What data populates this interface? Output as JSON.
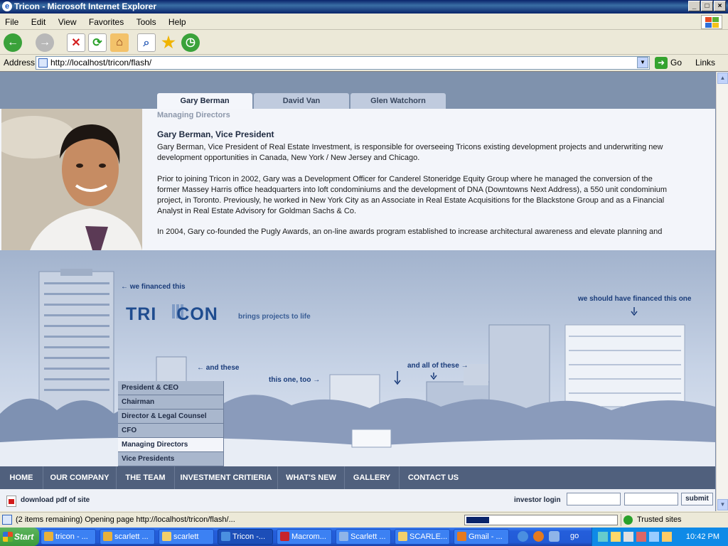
{
  "window": {
    "title": "Tricon - Microsoft Internet Explorer"
  },
  "menu": [
    "File",
    "Edit",
    "View",
    "Favorites",
    "Tools",
    "Help"
  ],
  "address": {
    "label": "Address",
    "url": "http://localhost/tricon/flash/",
    "go_label": "Go",
    "links_label": "Links"
  },
  "tabs": [
    {
      "label": "Gary Berman",
      "active": true
    },
    {
      "label": "David Van",
      "active": false
    },
    {
      "label": "Glen Watchorn",
      "active": false
    }
  ],
  "section_label": "Managing Directors",
  "bio": {
    "heading": "Gary Berman, Vice President",
    "paragraphs": [
      "Gary Berman, Vice President of Real Estate Investment, is responsible for overseeing Tricons existing development projects and underwriting new development opportunities in Canada, New York / New Jersey and Chicago.",
      "Prior to joining Tricon in 2002, Gary was a Development Officer for Canderel Stoneridge Equity Group where he managed the conversion of the former Massey Harris office headquarters into loft condominiums and the development of DNA (Downtowns Next Address), a 550 unit condominium project, in Toronto.  Previously, he worked in New York City as an Associate in Real Estate Acquisitions for the Blackstone Group and as a Financial Analyst in Real Estate Advisory for Goldman Sachs & Co.",
      "In 2004, Gary co-founded the Pugly Awards, an on-line awards program established to increase architectural awareness and elevate planning and"
    ]
  },
  "scene": {
    "logo": "TRI CON",
    "tagline": "brings projects to life",
    "notes": {
      "financed": "← we financed this",
      "should": "we should have financed this one",
      "and_these": "← and these",
      "this_one": "this one, too →",
      "all_these": "and all of these →"
    }
  },
  "side_menu": [
    {
      "label": "President & CEO",
      "active": false
    },
    {
      "label": "Chairman",
      "active": false
    },
    {
      "label": "Director & Legal Counsel",
      "active": false
    },
    {
      "label": "CFO",
      "active": false
    },
    {
      "label": "Managing Directors",
      "active": true
    },
    {
      "label": "Vice Presidents",
      "active": false
    }
  ],
  "nav": [
    "HOME",
    "OUR COMPANY",
    "THE TEAM",
    "INVESTMENT CRITIERIA",
    "WHAT'S NEW",
    "GALLERY",
    "CONTACT US"
  ],
  "footer": {
    "pdf_label": "download pdf of site",
    "login_label": "investor login",
    "submit_label": "submit"
  },
  "status": {
    "text": "(2 items remaining) Opening page http://localhost/tricon/flash/...",
    "zone": "Trusted sites",
    "progress": 0.15
  },
  "taskbar": {
    "start": "Start",
    "tasks": [
      {
        "label": "tricon - ...",
        "icon": "chrome-icon",
        "color": "#e8b13a",
        "active": false
      },
      {
        "label": "scarlett ...",
        "icon": "chrome-icon",
        "color": "#e8b13a",
        "active": false
      },
      {
        "label": "scarlett",
        "icon": "folder-icon",
        "color": "#f2d06b",
        "active": false
      },
      {
        "label": "Tricon -...",
        "icon": "ie-icon",
        "color": "#4a8fe0",
        "active": true
      },
      {
        "label": "Macrom...",
        "icon": "flash-icon",
        "color": "#c8242a",
        "active": false
      },
      {
        "label": "Scarlett ...",
        "icon": "app-icon",
        "color": "#8fb4e8",
        "active": false
      },
      {
        "label": "SCARLE...",
        "icon": "folder-icon",
        "color": "#f2d06b",
        "active": false
      },
      {
        "label": "Gmail - ...",
        "icon": "firefox-icon",
        "color": "#e57a1f",
        "active": false
      }
    ],
    "go_label": "go",
    "clock": "10:42 PM"
  }
}
